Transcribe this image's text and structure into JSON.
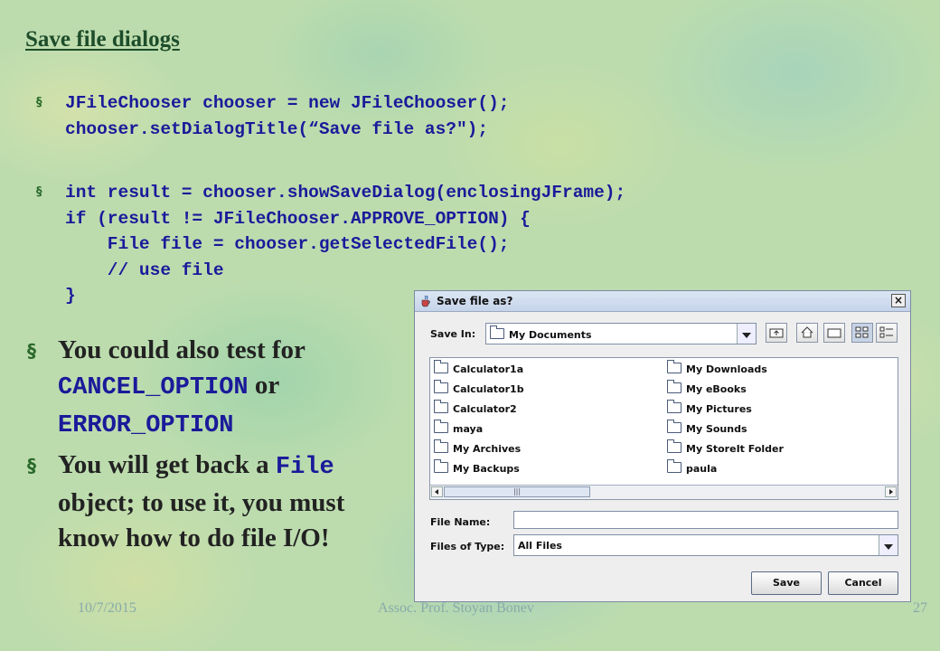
{
  "title": "Save file dialogs",
  "code_block_1": {
    "line1": "JFileChooser chooser = new JFileChooser();",
    "line2": "chooser.setDialogTitle(“Save file as?\");"
  },
  "code_block_2": {
    "line1": "int result = chooser.showSaveDialog(enclosingJFrame);",
    "line2": "if (result != JFileChooser.APPROVE_OPTION) {",
    "line3": "    File file = chooser.getSelectedFile();",
    "line4": "    // use file",
    "line5": "}"
  },
  "bullet1": {
    "a": "You could also test for ",
    "b": "CANCEL_OPTION",
    "c": " or ",
    "d": "ERROR_OPTION"
  },
  "bullet2": {
    "a": "You will get back a ",
    "b": "File",
    "c": " object; to use it, you must know how to do file I/O!"
  },
  "footer": {
    "date": "10/7/2015",
    "author": "Assoc. Prof. Stoyan Bonev",
    "page": "27"
  },
  "dialog": {
    "title": "Save file as?",
    "close_glyph": "×",
    "save_in_label": "Save In:",
    "save_in_value": "My Documents",
    "files_left": [
      "Calculator1a",
      "Calculator1b",
      "Calculator2",
      "maya",
      "My Archives",
      "My Backups"
    ],
    "files_right": [
      "My Downloads",
      "My eBooks",
      "My Pictures",
      "My Sounds",
      "My StoreIt Folder",
      "paula"
    ],
    "scroll_thumb_glyph": "|||",
    "file_name_label": "File Name:",
    "file_name_value": "",
    "files_of_type_label": "Files of Type:",
    "files_of_type_value": "All Files",
    "save_button": "Save",
    "cancel_button": "Cancel"
  }
}
